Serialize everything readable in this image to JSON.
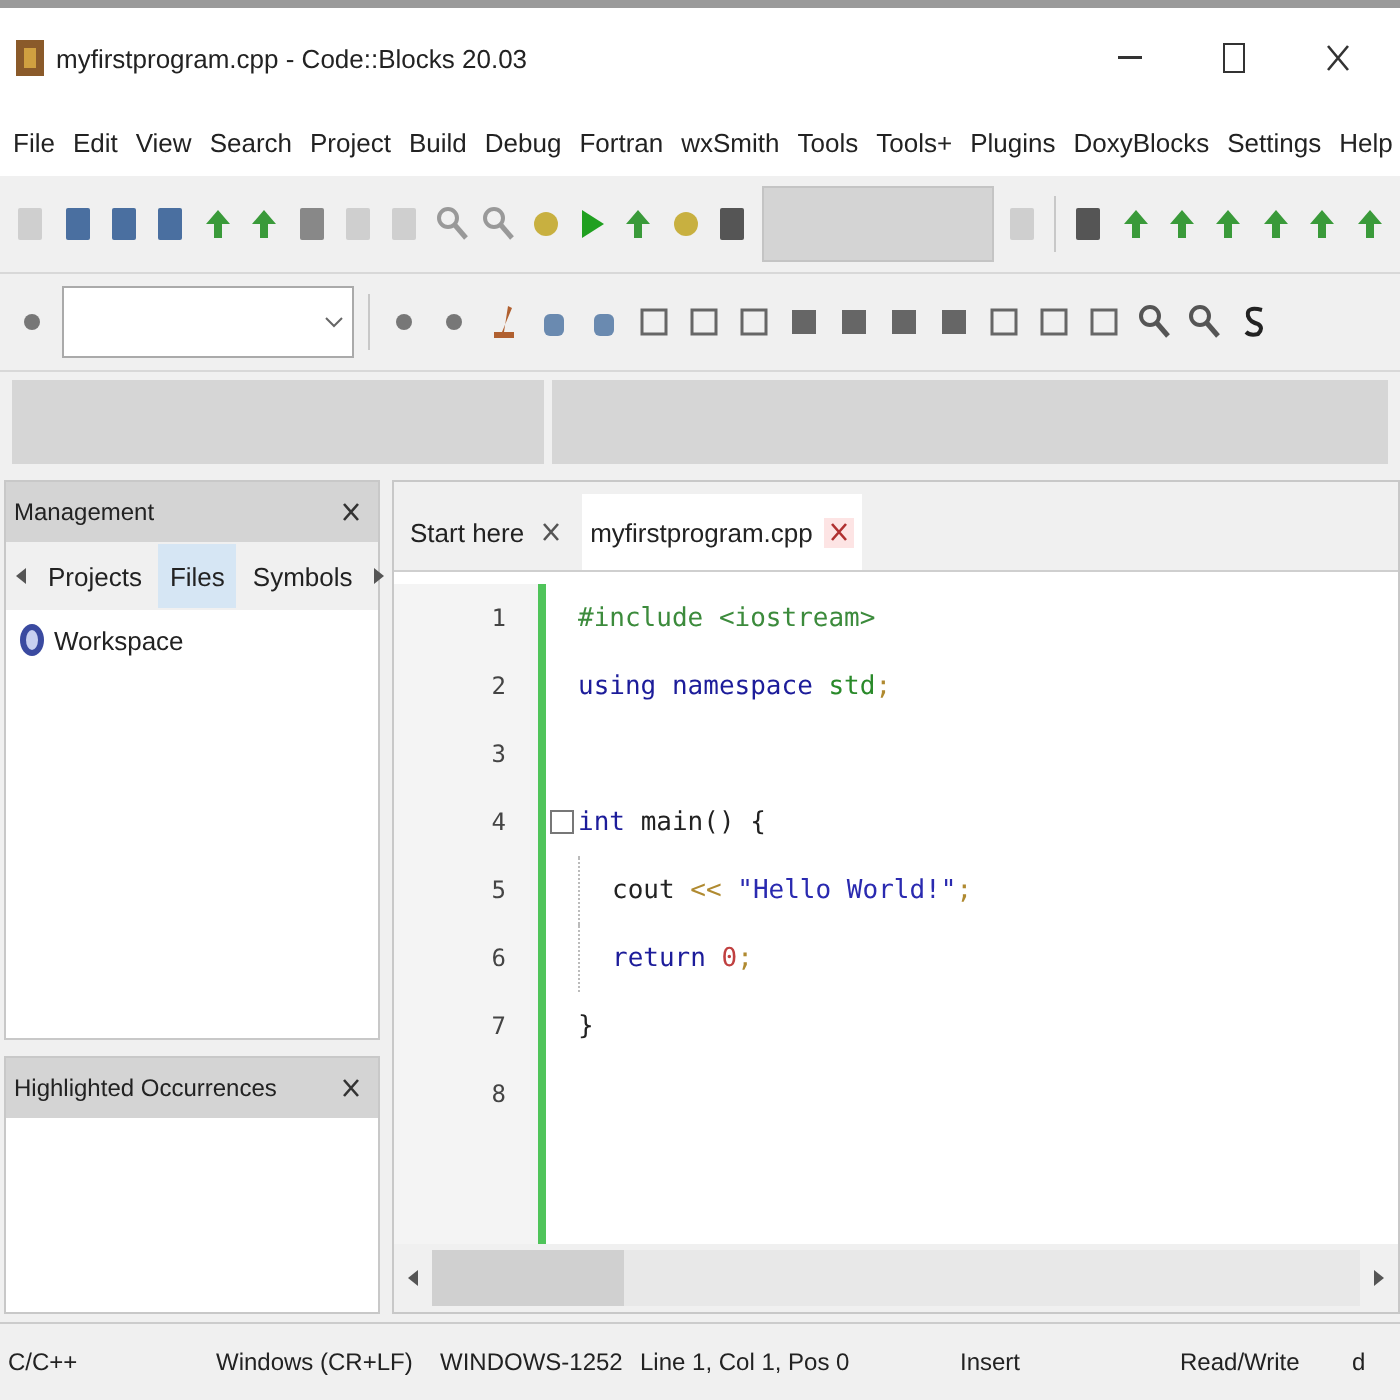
{
  "window": {
    "title": "myfirstprogram.cpp - Code::Blocks 20.03"
  },
  "menu": [
    "File",
    "Edit",
    "View",
    "Search",
    "Project",
    "Build",
    "Debug",
    "Fortran",
    "wxSmith",
    "Tools",
    "Tools+",
    "Plugins",
    "DoxyBlocks",
    "Settings",
    "Help"
  ],
  "management": {
    "title": "Management",
    "tabs": [
      {
        "label": "Projects",
        "selected": false
      },
      {
        "label": "Files",
        "selected": true
      },
      {
        "label": "Symbols",
        "selected": false
      }
    ],
    "tree": [
      {
        "label": "Workspace"
      }
    ]
  },
  "highlighted": {
    "title": "Highlighted Occurrences"
  },
  "editor": {
    "tabs": [
      {
        "label": "Start here",
        "selected": false
      },
      {
        "label": "myfirstprogram.cpp",
        "selected": true
      }
    ],
    "lines": [
      {
        "number": "1",
        "indented": false,
        "fold": false,
        "tokens": [
          {
            "kind": "preproc",
            "text": "#include <iostream>"
          }
        ]
      },
      {
        "number": "2",
        "indented": false,
        "fold": false,
        "tokens": [
          {
            "kind": "keyword",
            "text": "using namespace "
          },
          {
            "kind": "ident",
            "text": "std"
          },
          {
            "kind": "op",
            "text": ";"
          }
        ]
      },
      {
        "number": "3",
        "indented": false,
        "fold": false
      },
      {
        "number": "4",
        "indented": false,
        "fold": true,
        "tokens": [
          {
            "kind": "keyword",
            "text": "int "
          },
          {
            "kind": "plain",
            "text": "main() {"
          }
        ]
      },
      {
        "number": "5",
        "indented": true,
        "fold": false,
        "tokens": [
          {
            "kind": "plain",
            "text": "cout "
          },
          {
            "kind": "op",
            "text": "<< "
          },
          {
            "kind": "string",
            "text": "\"Hello World!\""
          },
          {
            "kind": "op",
            "text": ";"
          }
        ]
      },
      {
        "number": "6",
        "indented": true,
        "fold": false,
        "tokens": [
          {
            "kind": "keyword",
            "text": "return "
          },
          {
            "kind": "number",
            "text": "0"
          },
          {
            "kind": "op",
            "text": ";"
          }
        ]
      },
      {
        "number": "7",
        "indented": false,
        "fold": false,
        "tokens": [
          {
            "kind": "plain",
            "text": "}"
          }
        ]
      },
      {
        "number": "8",
        "indented": false,
        "fold": false
      }
    ]
  },
  "status_bar": [
    "C/C++",
    "Windows (CR+LF)",
    "WINDOWS-1252",
    "Line 1, Col 1, Pos 0",
    "Insert",
    "Read/Write",
    "d"
  ]
}
